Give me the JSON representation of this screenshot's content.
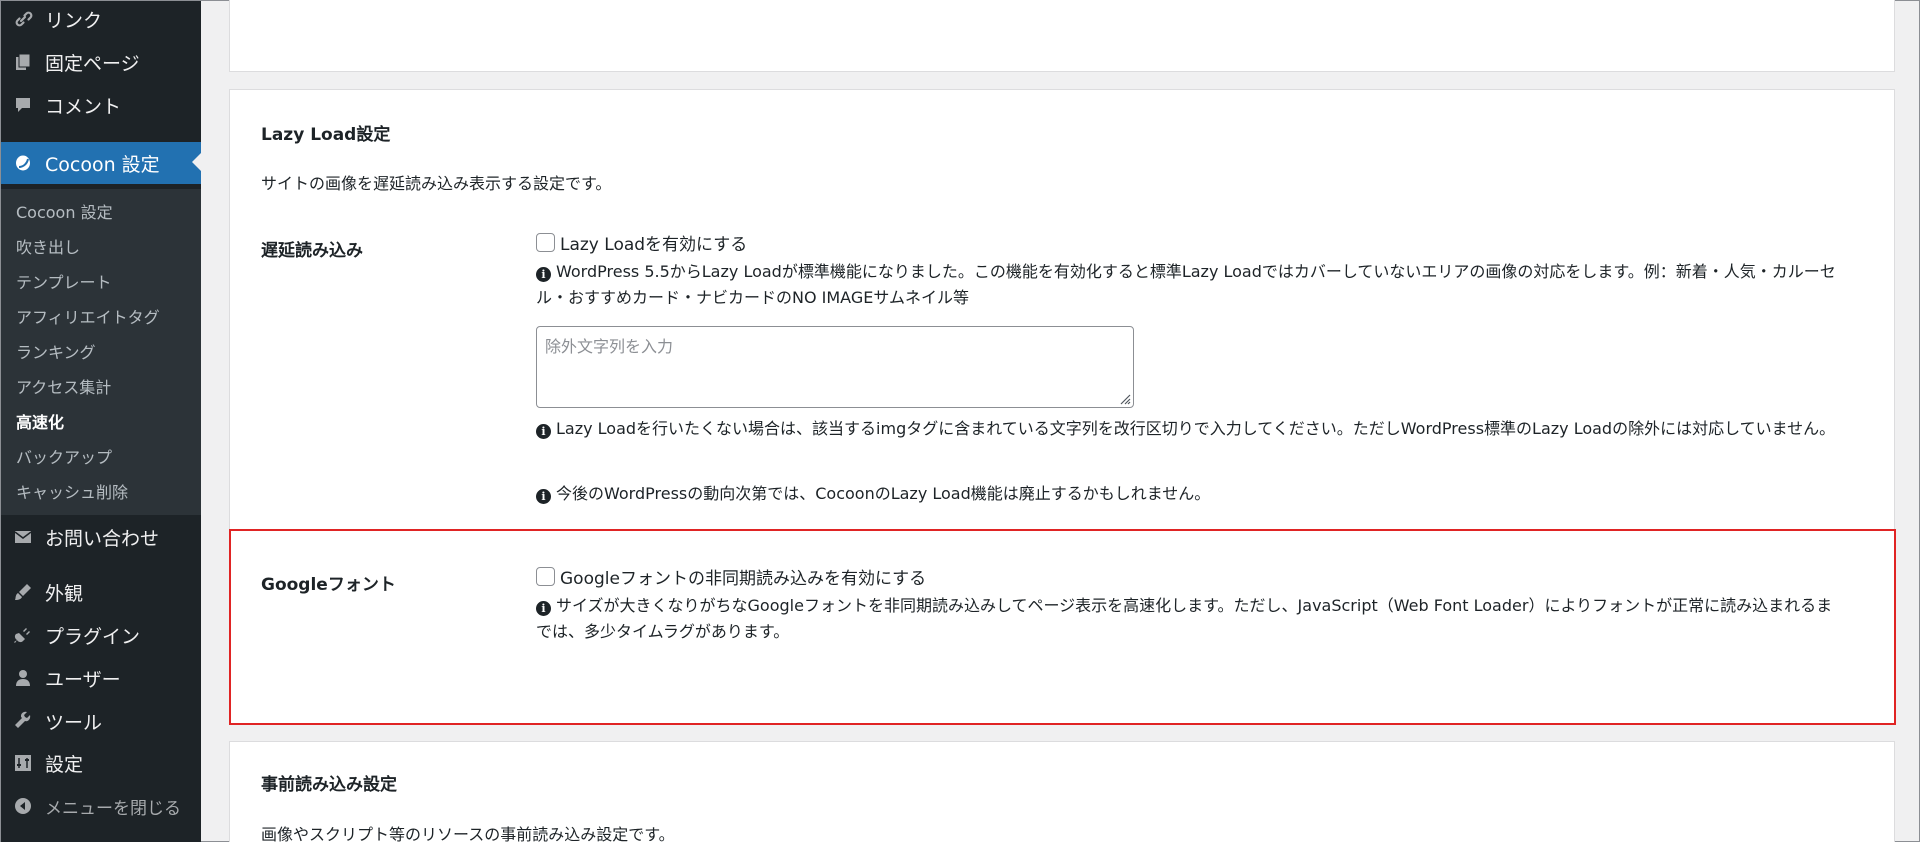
{
  "sidebar": {
    "menu": [
      {
        "label": "リンク",
        "icon": "link-icon"
      },
      {
        "label": "固定ページ",
        "icon": "pages-icon"
      },
      {
        "label": "コメント",
        "icon": "comment-icon"
      },
      {
        "label": "Cocoon 設定",
        "icon": "cocoon-icon"
      },
      {
        "label": "お問い合わせ",
        "icon": "mail-icon"
      },
      {
        "label": "外観",
        "icon": "brush-icon"
      },
      {
        "label": "プラグイン",
        "icon": "plugin-icon"
      },
      {
        "label": "ユーザー",
        "icon": "user-icon"
      },
      {
        "label": "ツール",
        "icon": "wrench-icon"
      },
      {
        "label": "設定",
        "icon": "settings-icon"
      },
      {
        "label": "メニューを閉じる",
        "icon": "collapse-icon"
      }
    ],
    "submenu": [
      "Cocoon 設定",
      "吹き出し",
      "テンプレート",
      "アフィリエイトタグ",
      "ランキング",
      "アクセス集計",
      "高速化",
      "バックアップ",
      "キャッシュ削除"
    ],
    "active_submenu": "高速化",
    "current_menu": "Cocoon 設定"
  },
  "lazy_load": {
    "title": "Lazy Load設定",
    "description": "サイトの画像を遅延読み込み表示する設定です。",
    "row_label": "遅延読み込み",
    "checkbox_label": "Lazy Loadを有効にする",
    "checked": false,
    "note1": "WordPress 5.5からLazy Loadが標準機能になりました。この機能を有効化すると標準Lazy Loadではカバーしていないエリアの画像の対応をします。例：新着・人気・カルーセル・おすすめカード・ナビカードのNO IMAGEサムネイル等",
    "exclude_placeholder": "除外文字列を入力",
    "exclude_value": "",
    "note2": "Lazy Loadを行いたくない場合は、該当するimgタグに含まれている文字列を改行区切りで入力してください。ただしWordPress標準のLazy Loadの除外には対応していません。",
    "note3": "今後のWordPressの動向次第では、CocoonのLazy Load機能は廃止するかもしれません。"
  },
  "google_font": {
    "row_label": "Googleフォント",
    "checkbox_label": "Googleフォントの非同期読み込みを有効にする",
    "checked": false,
    "note": "サイズが大きくなりがちなGoogleフォントを非同期読み込みしてページ表示を高速化します。ただし、JavaScript（Web Font Loader）によりフォントが正常に読み込まれるまでは、多少タイムラグがあります。"
  },
  "preload": {
    "title": "事前読み込み設定",
    "description": "画像やスクリプト等のリソースの事前読み込み設定です。"
  },
  "colors": {
    "sidebar_bg": "#1d2327",
    "submenu_bg": "#2c3338",
    "accent": "#2271b1",
    "highlight_border": "#e02424"
  }
}
